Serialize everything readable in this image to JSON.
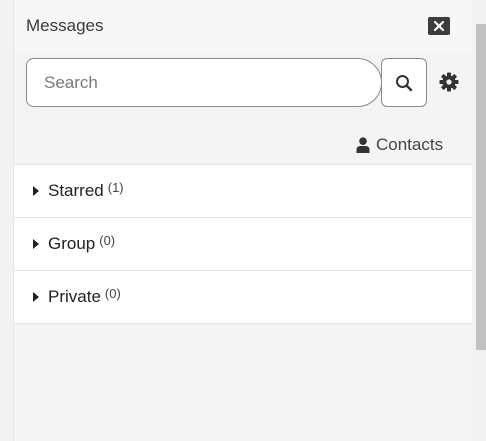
{
  "header": {
    "title": "Messages",
    "close_icon": "close-icon"
  },
  "search": {
    "placeholder": "Search",
    "value": ""
  },
  "contacts": {
    "label": "Contacts",
    "icon": "user-icon"
  },
  "groups": [
    {
      "label": "Starred",
      "count": "(1)"
    },
    {
      "label": "Group",
      "count": "(0)"
    },
    {
      "label": "Private",
      "count": "(0)"
    }
  ],
  "colors": {
    "accent": "#f5c518",
    "close_bg": "#3d3d3d"
  }
}
